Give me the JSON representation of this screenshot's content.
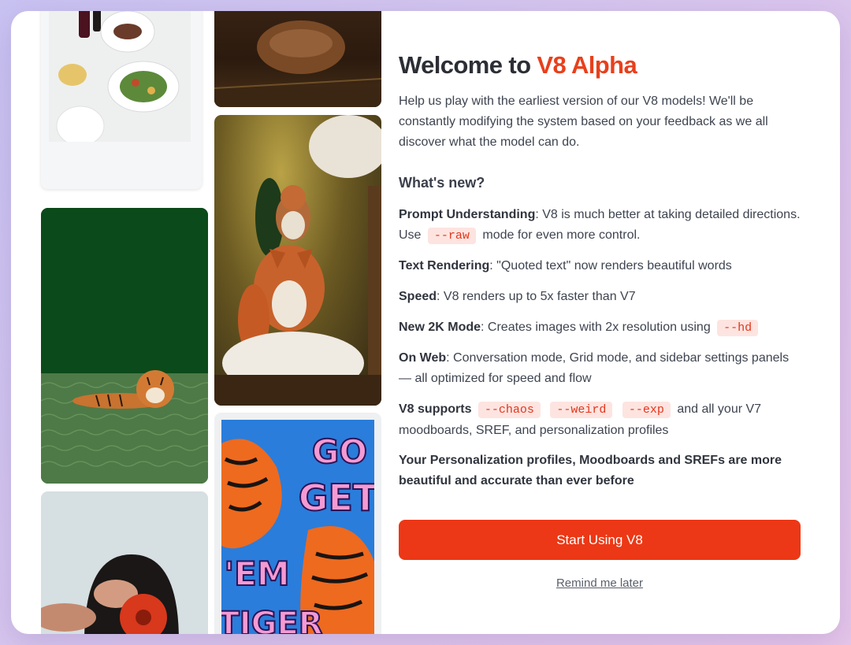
{
  "modal": {
    "title_prefix": "Welcome to ",
    "title_accent": "V8 Alpha",
    "intro": "Help us play with the earliest version of our V8 models! We'll be constantly modifying the system based on your feedback as we all discover what the model can do.",
    "whats_new_heading": "What's new?",
    "features": {
      "prompt": {
        "label": "Prompt Understanding",
        "text_before": ": V8 is much better at taking detailed directions. Use",
        "code": "--raw",
        "text_after": "mode for even more control."
      },
      "text_rendering": {
        "label": "Text Rendering",
        "text": ": \"Quoted text\" now renders beautiful words"
      },
      "speed": {
        "label": "Speed",
        "text": ": V8 renders up to 5x faster than V7"
      },
      "mode2k": {
        "label": "New 2K Mode",
        "text": ": Creates images with 2x resolution using",
        "code": "--hd"
      },
      "web": {
        "label": "On Web",
        "text": ": Conversation mode, Grid mode, and sidebar settings panels — all optimized for speed and flow"
      },
      "supports": {
        "label": "V8 supports",
        "codes": [
          "--chaos",
          "--weird",
          "--exp"
        ],
        "text": "and all your V7 moodboards, SREF, and personalization profiles"
      },
      "personalization": "Your Personalization profiles, Moodboards and SREFs are more beautiful and accurate than ever before"
    },
    "primary_button": "Start Using V8",
    "secondary_link": "Remind me later"
  },
  "poster": {
    "line1": "GO",
    "line2": "GET",
    "line3": "'EM",
    "line4": "TIGER"
  },
  "colors": {
    "accent": "#e8401c",
    "button": "#ec3816",
    "code_bg": "#fde4e0",
    "code_fg": "#e2361c"
  }
}
